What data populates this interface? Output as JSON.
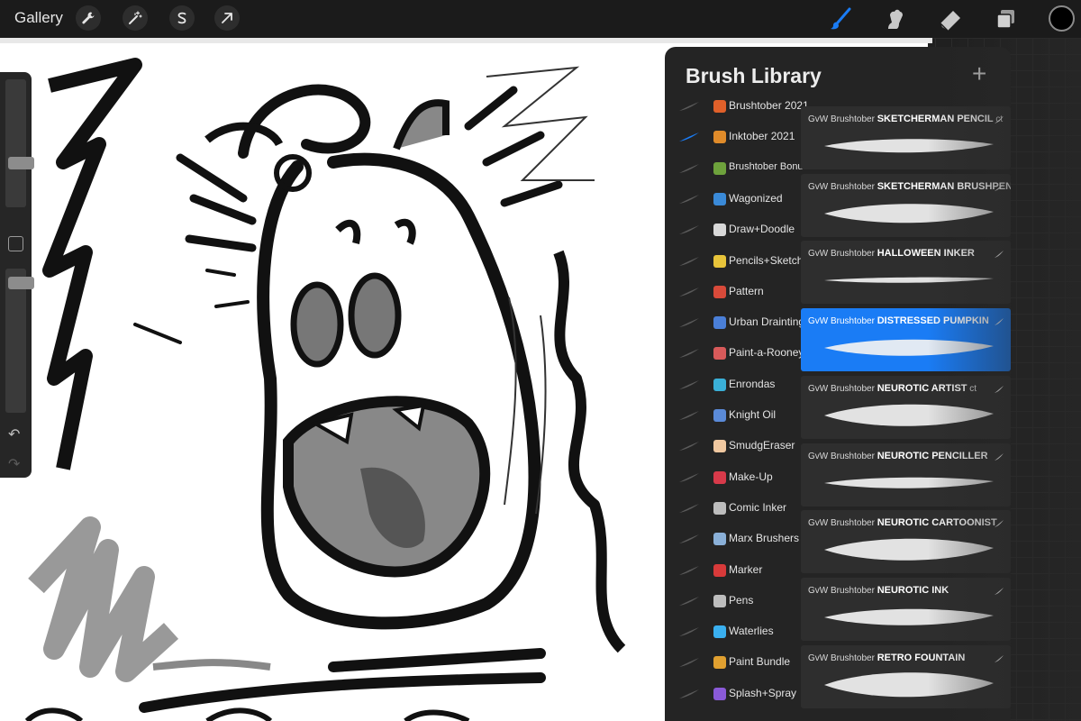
{
  "toolbar": {
    "gallery_label": "Gallery",
    "left_tools": [
      "wrench-icon",
      "magic-wand-icon",
      "selection-icon",
      "transform-arrow-icon"
    ],
    "right_tools": [
      "brush-icon",
      "smudge-icon",
      "eraser-icon",
      "layers-icon"
    ],
    "active_tool": "brush-icon",
    "active_color": "#000000",
    "accent_color": "#1a7cf5"
  },
  "sidebar": {
    "size_slider_level": 0.64,
    "opacity_slider_level": 0.94,
    "undo_icon": "undo-icon",
    "redo_icon": "redo-icon"
  },
  "brush_library": {
    "title": "Brush Library",
    "add_icon": "plus-icon",
    "sets": [
      {
        "label": "Brushtober 2021",
        "icon_color": "#e0602a",
        "active": false
      },
      {
        "label": "Inktober 2021",
        "icon_color": "#e08b2a",
        "active": true
      },
      {
        "label": "Brushtober Bonus",
        "icon_color": "#6ea23c",
        "active": false
      },
      {
        "label": "Wagonized",
        "icon_color": "#3a8ad8",
        "active": false
      },
      {
        "label": "Draw+Doodle",
        "icon_color": "#d8d8d8",
        "active": false
      },
      {
        "label": "Pencils+Sketch",
        "icon_color": "#e8c43a",
        "active": false
      },
      {
        "label": "Pattern",
        "icon_color": "#d84a3a",
        "active": false
      },
      {
        "label": "Urban Drainting",
        "icon_color": "#4a7fd8",
        "active": false
      },
      {
        "label": "Paint-a-Rooney",
        "icon_color": "#d85a5a",
        "active": false
      },
      {
        "label": "Enrondas",
        "icon_color": "#3ab0d8",
        "active": false
      },
      {
        "label": "Knight Oil",
        "icon_color": "#5a8ad8",
        "active": false
      },
      {
        "label": "SmudgEraser",
        "icon_color": "#f0c8a0",
        "active": false
      },
      {
        "label": "Make-Up",
        "icon_color": "#d83a4a",
        "active": false
      },
      {
        "label": "Comic Inker",
        "icon_color": "#bdbdbd",
        "active": false
      },
      {
        "label": "Marx Brushers",
        "icon_color": "#8ab0d8",
        "active": false
      },
      {
        "label": "Marker",
        "icon_color": "#d83a3a",
        "active": false
      },
      {
        "label": "Pens",
        "icon_color": "#bdbdbd",
        "active": false
      },
      {
        "label": "Waterlies",
        "icon_color": "#3ab0f0",
        "active": false
      },
      {
        "label": "Paint Bundle",
        "icon_color": "#e0a030",
        "active": false
      },
      {
        "label": "Splash+Spray",
        "icon_color": "#8a5ad8",
        "active": false
      }
    ],
    "brushes": [
      {
        "prefix": "GvW Brushtober",
        "name": "SKETCHERMAN PENCIL",
        "suffix": "ct",
        "active": false
      },
      {
        "prefix": "GvW Brushtober",
        "name": "SKETCHERMAN BRUSHPEN",
        "suffix": "",
        "active": false
      },
      {
        "prefix": "GvW Brushtober",
        "name": "HALLOWEEN INKER",
        "suffix": "",
        "active": false
      },
      {
        "prefix": "GvW Brushtober",
        "name": "DISTRESSED PUMPKIN",
        "suffix": "",
        "active": true
      },
      {
        "prefix": "GvW Brushtober",
        "name": "NEUROTIC ARTIST",
        "suffix": "ct",
        "active": false
      },
      {
        "prefix": "GvW Brushtober",
        "name": "NEUROTIC PENCILLER",
        "suffix": "",
        "active": false
      },
      {
        "prefix": "GvW Brushtober",
        "name": "NEUROTIC CARTOONIST",
        "suffix": "",
        "active": false
      },
      {
        "prefix": "GvW Brushtober",
        "name": "NEUROTIC INK",
        "suffix": "",
        "active": false
      },
      {
        "prefix": "GvW Brushtober",
        "name": "RETRO FOUNTAIN",
        "suffix": "",
        "active": false
      }
    ]
  }
}
